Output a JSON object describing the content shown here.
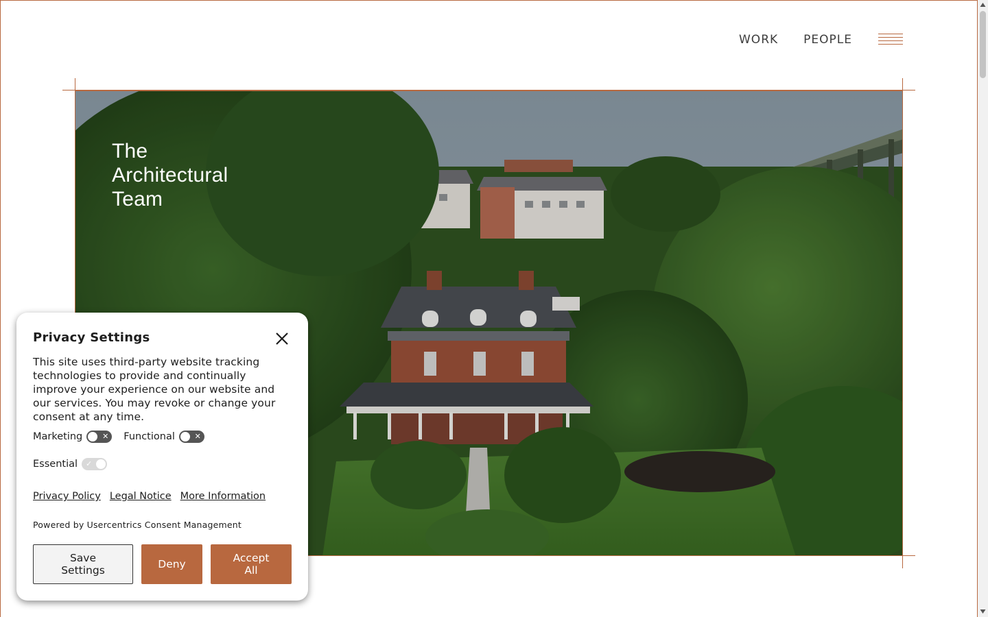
{
  "nav": {
    "work": "WORK",
    "people": "PEOPLE"
  },
  "hero": {
    "title": "The\nArchitectural\nTeam"
  },
  "consent": {
    "title": "Privacy Settings",
    "body": "This site uses third-party website tracking technologies to provide and continually improve your experience on our website and our services. You may revoke or change your consent at any time.",
    "toggles": [
      {
        "label": "Marketing",
        "state": "off"
      },
      {
        "label": "Functional",
        "state": "off"
      },
      {
        "label": "Essential",
        "state": "on"
      }
    ],
    "links": {
      "privacy": "Privacy Policy",
      "legal": "Legal Notice",
      "more": "More Information"
    },
    "powered_by": "Powered by Usercentrics Consent Management",
    "buttons": {
      "save": "Save Settings",
      "deny": "Deny",
      "accept": "Accept All"
    }
  },
  "colors": {
    "accent": "#b8683f",
    "text": "#1e1e1e",
    "nav_text": "#3d3d3d"
  }
}
